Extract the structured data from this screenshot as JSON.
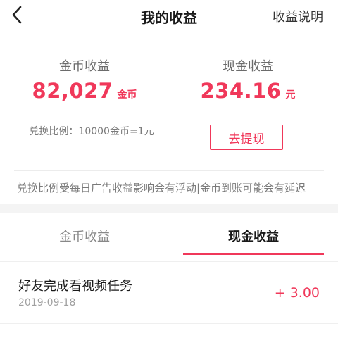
{
  "header": {
    "title": "我的收益",
    "help_link": "收益说明",
    "back_icon": "chevron-left-icon"
  },
  "summary": {
    "coin": {
      "label": "金币收益",
      "value": "82,027",
      "unit": "金币",
      "rate_text": "兑换比例：10000金币=1元"
    },
    "cash": {
      "label": "现金收益",
      "value": "234.16",
      "unit": "元",
      "withdraw_label": "去提现"
    },
    "notice": "兑换比例受每日广告收益影响会有浮动|金币到账可能会有延迟"
  },
  "tabs": [
    {
      "label": "金币收益",
      "active": false
    },
    {
      "label": "现金收益",
      "active": true
    }
  ],
  "records": [
    {
      "title": "好友完成看视频任务",
      "date": "2019-09-18",
      "amount": "+ 3.00"
    }
  ],
  "colors": {
    "accent": "#f0385a",
    "text": "#1a1a1a",
    "muted": "#7a7a7a",
    "band": "#f4f4f4"
  }
}
